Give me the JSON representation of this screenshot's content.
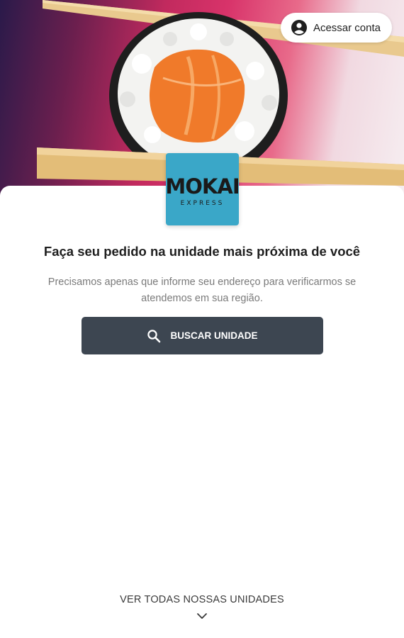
{
  "header": {
    "account_label": "Acessar conta",
    "account_icon": "account-circle-icon"
  },
  "brand": {
    "logo_text": "MOKAI",
    "logo_subtext": "EXPRESS",
    "logo_color": "#3aa7c8"
  },
  "main": {
    "headline": "Faça seu pedido na unidade mais próxima de você",
    "description": "Precisamos apenas que informe seu endereço para verificarmos se atendemos em sua região.",
    "search_button_label": "BUSCAR UNIDADE",
    "search_button_icon": "search-icon",
    "search_button_color": "#3d4651"
  },
  "footer": {
    "all_units_label": "VER TODAS NOSSAS UNIDADES",
    "chevron_icon": "chevron-down-icon"
  }
}
